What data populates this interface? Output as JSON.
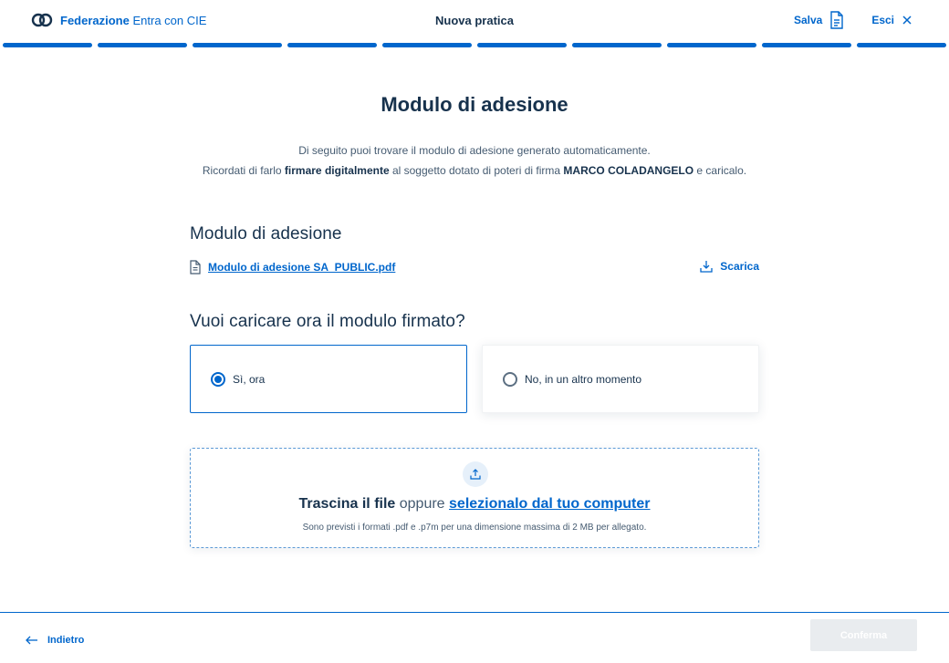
{
  "header": {
    "brand_bold": "Federazione",
    "brand_light": "Entra con CIE",
    "title": "Nuova pratica",
    "save_label": "Salva",
    "exit_label": "Esci"
  },
  "stepper": {
    "total_steps": 10,
    "completed_steps": 10
  },
  "main": {
    "title": "Modulo di adesione",
    "intro_line1": "Di seguito puoi trovare il modulo di adesione generato automaticamente.",
    "intro_line2_a": "Ricordati di farlo ",
    "intro_line2_b": "firmare digitalmente",
    "intro_line2_c": " al soggetto dotato di poteri di firma ",
    "intro_line2_d": "MARCO COLADANGELO",
    "intro_line2_e": " e caricalo.",
    "module_section_title": "Modulo di adesione",
    "file_name": "Modulo di adesione SA_PUBLIC.pdf",
    "download_label": "Scarica",
    "upload_question": "Vuoi caricare ora il modulo firmato?",
    "options": [
      {
        "label": "Sì, ora",
        "selected": true
      },
      {
        "label": "No, in un altro momento",
        "selected": false
      }
    ],
    "dropzone": {
      "drag_text": "Trascina il file",
      "or_text": " oppure ",
      "select_text": "selezionalo dal tuo computer",
      "hint": "Sono previsti i formati .pdf e .p7m per una dimensione massima di 2 MB per allegato."
    }
  },
  "footer": {
    "back_label": "Indietro",
    "confirm_label": "Conferma"
  },
  "colors": {
    "primary": "#0066cc",
    "text": "#17324d",
    "disabled_button": "#e9ecef"
  }
}
